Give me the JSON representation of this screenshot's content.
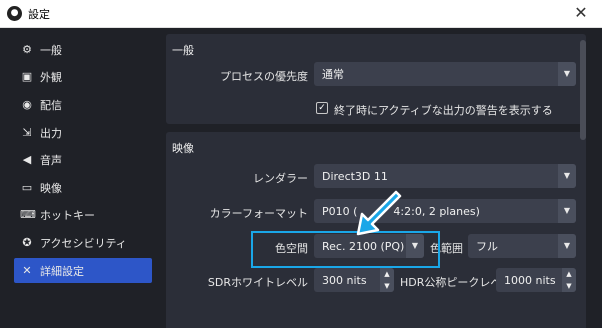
{
  "window": {
    "title": "設定",
    "close_glyph": "✕"
  },
  "sidebar": {
    "items": [
      {
        "label": "一般",
        "icon": "gear-icon",
        "glyph": "⚙"
      },
      {
        "label": "外観",
        "icon": "appearance-icon",
        "glyph": "▣"
      },
      {
        "label": "配信",
        "icon": "broadcast-icon",
        "glyph": "◉"
      },
      {
        "label": "出力",
        "icon": "output-icon",
        "glyph": "⇲"
      },
      {
        "label": "音声",
        "icon": "speaker-icon",
        "glyph": "◀"
      },
      {
        "label": "映像",
        "icon": "monitor-icon",
        "glyph": "▭"
      },
      {
        "label": "ホットキー",
        "icon": "keyboard-icon",
        "glyph": "⌨"
      },
      {
        "label": "アクセシビリティ",
        "icon": "accessibility-icon",
        "glyph": "✪"
      },
      {
        "label": "詳細設定",
        "icon": "tools-icon",
        "glyph": "✕"
      }
    ],
    "active_index": 8
  },
  "general": {
    "title": "一般",
    "priority_label": "プロセスの優先度",
    "priority_value": "通常",
    "warn_checkbox_label": "終了時にアクティブな出力の警告を表示する",
    "warn_checked": true
  },
  "video": {
    "title": "映像",
    "renderer_label": "レンダラー",
    "renderer_value": "Direct3D 11",
    "color_format_label": "カラーフォーマット",
    "color_format_value": "P010 (",
    "color_format_value_tail": "4:2:0, 2 planes)",
    "color_space_label": "色空間",
    "color_space_value": "Rec. 2100 (PQ)",
    "color_range_label": "色範囲",
    "color_range_value": "フル",
    "sdr_white_label": "SDRホワイトレベル",
    "sdr_white_value": "300 nits",
    "hdr_peak_label": "HDR公称ピークレベル",
    "hdr_peak_value": "1000 nits"
  },
  "colors": {
    "accent": "#2d56c8",
    "highlight": "#1aa7e8",
    "panel": "#2b2e38"
  }
}
